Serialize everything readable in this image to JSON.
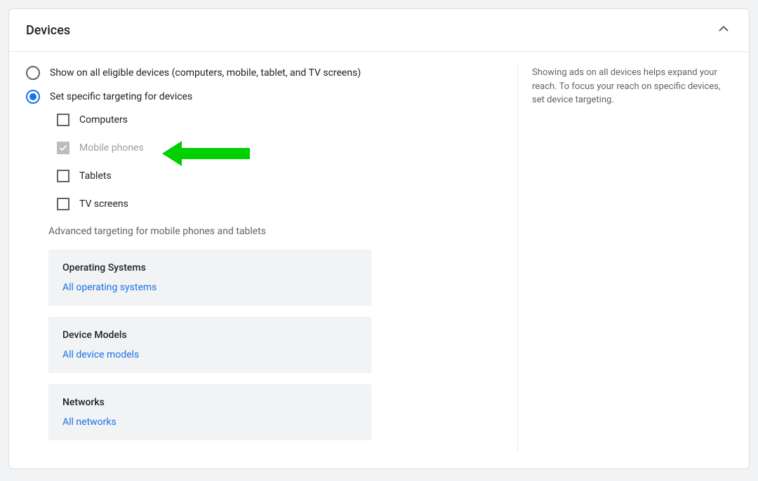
{
  "header": {
    "title": "Devices"
  },
  "radios": {
    "all": {
      "label": "Show on all eligible devices (computers, mobile, tablet, and TV screens)",
      "selected": false
    },
    "specific": {
      "label": "Set specific targeting for devices",
      "selected": true
    }
  },
  "checkboxes": {
    "computers": {
      "label": "Computers",
      "checked": false,
      "disabled": false
    },
    "mobile": {
      "label": "Mobile phones",
      "checked": true,
      "disabled": true
    },
    "tablets": {
      "label": "Tablets",
      "checked": false,
      "disabled": false
    },
    "tv": {
      "label": "TV screens",
      "checked": false,
      "disabled": false
    }
  },
  "advanced": {
    "heading": "Advanced targeting for mobile phones and tablets",
    "os": {
      "title": "Operating Systems",
      "link": "All operating systems"
    },
    "models": {
      "title": "Device Models",
      "link": "All device models"
    },
    "networks": {
      "title": "Networks",
      "link": "All networks"
    }
  },
  "help_text": "Showing ads on all devices helps expand your reach. To focus your reach on specific devices, set device targeting."
}
